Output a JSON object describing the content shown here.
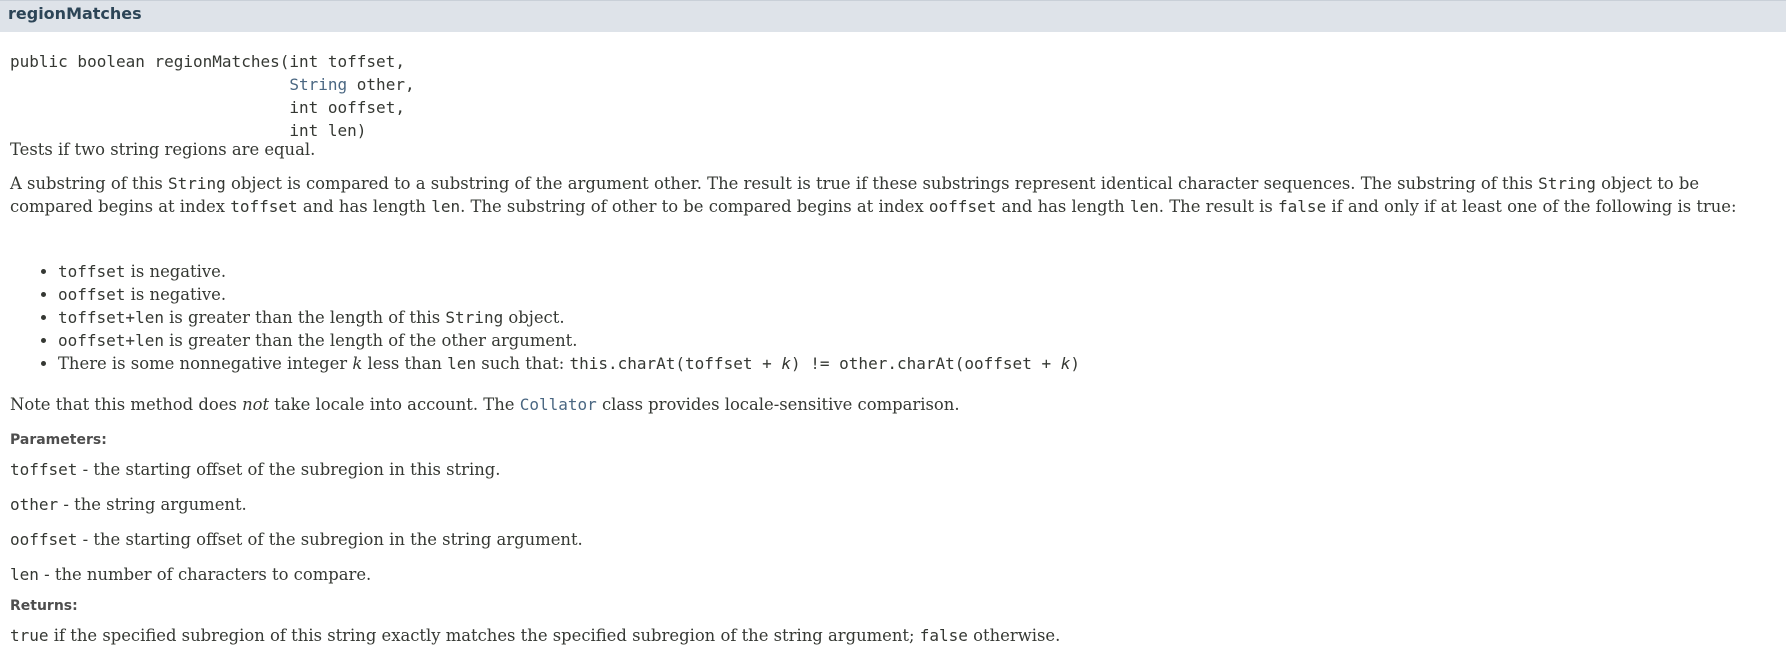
{
  "header": {
    "title": "regionMatches"
  },
  "signature": {
    "line1": "public boolean regionMatches(int toffset,",
    "indent": "                             ",
    "p2_type": "String",
    "p2_name": " other,",
    "p3": "int ooffset,",
    "p4": "int len)"
  },
  "summary": "Tests if two string regions are equal.",
  "description": {
    "t1": "A substring of this ",
    "c1": "String",
    "t2": " object is compared to a substring of the argument other. The result is true if these substrings represent identical character sequences. The substring of this ",
    "c2": "String",
    "t3": " object to be compared begins at index ",
    "c3": "toffset",
    "t4": " and has length ",
    "c4": "len",
    "t5": ". The substring of other to be compared begins at index ",
    "c5": "ooffset",
    "t6": " and has length ",
    "c6": "len",
    "t7": ". The result is ",
    "c7": "false",
    "t8": " if and only if at least one of the following is true:"
  },
  "conditions": [
    {
      "code": "toffset",
      "text": " is negative."
    },
    {
      "code": "ooffset",
      "text": " is negative."
    },
    {
      "code": "toffset+len",
      "text": " is greater than the length of this ",
      "code2": "String",
      "text2": " object."
    },
    {
      "code": "ooffset+len",
      "text": " is greater than the length of the other argument."
    },
    {
      "t1": "There is some nonnegative integer ",
      "k": "k",
      "t2": " less than ",
      "c_len": "len",
      "t3": " such that: ",
      "expr1": "this.charAt(toffset + ",
      "expr_k1": "k",
      "expr2": ") != other.charAt(ooffset + ",
      "expr_k2": "k",
      "expr3": ")"
    }
  ],
  "note": {
    "t1": "Note that this method does ",
    "em": "not",
    "t2": " take locale into account. The ",
    "link": "Collator",
    "t3": " class provides locale-sensitive comparison."
  },
  "parameters": {
    "label": "Parameters:",
    "items": [
      {
        "name": "toffset",
        "desc": " - the starting offset of the subregion in this string."
      },
      {
        "name": "other",
        "desc": " - the string argument."
      },
      {
        "name": "ooffset",
        "desc": " - the starting offset of the subregion in the string argument."
      },
      {
        "name": "len",
        "desc": " - the number of characters to compare."
      }
    ]
  },
  "returns": {
    "label": "Returns:",
    "c1": "true",
    "t1": " if the specified subregion of this string exactly matches the specified subregion of the string argument; ",
    "c2": "false",
    "t2": " otherwise."
  }
}
